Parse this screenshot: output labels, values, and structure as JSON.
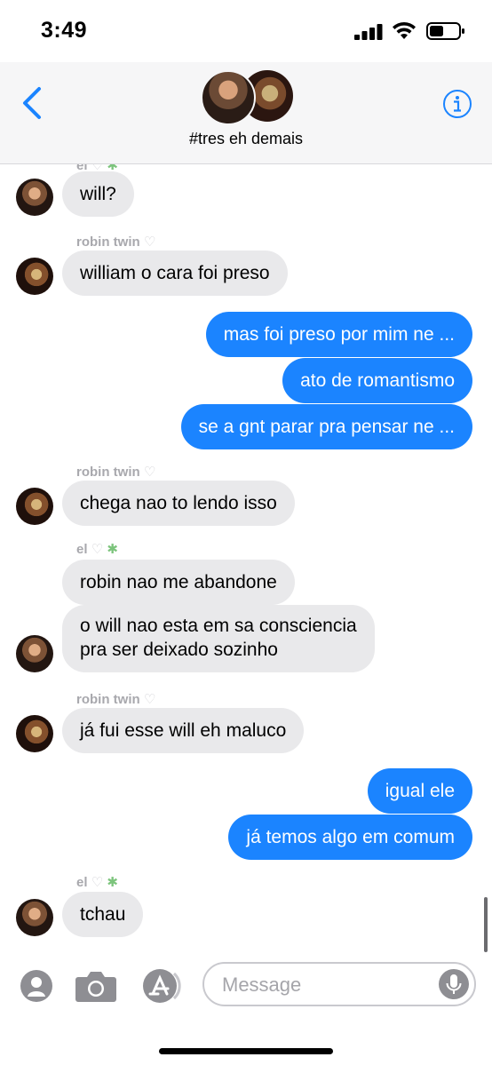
{
  "status_bar": {
    "time": "3:49"
  },
  "header": {
    "group_name": "#tres eh demais"
  },
  "senders": {
    "el": "el",
    "robin": "robin twin"
  },
  "messages": [
    {
      "from": "el",
      "text": "will?"
    },
    {
      "from": "robin",
      "text": "william o cara foi preso"
    },
    {
      "from": "me",
      "text": "mas foi preso por mim ne ..."
    },
    {
      "from": "me",
      "text": "ato de romantismo"
    },
    {
      "from": "me",
      "text": "se a gnt parar pra pensar ne ..."
    },
    {
      "from": "robin",
      "text": "chega nao to lendo isso"
    },
    {
      "from": "el",
      "text": "robin nao me abandone"
    },
    {
      "from": "el",
      "text_line1": "o will nao esta em sa consciencia",
      "text_line2": "pra ser deixado sozinho"
    },
    {
      "from": "robin",
      "text": "já fui esse will eh maluco"
    },
    {
      "from": "me",
      "text": "igual ele"
    },
    {
      "from": "me",
      "text": "já temos algo em comum"
    },
    {
      "from": "el",
      "text": "tchau"
    }
  ],
  "input": {
    "placeholder": "Message"
  },
  "icons": {
    "back": "chevron-left-icon",
    "info": "info-icon",
    "contact": "person-icon",
    "camera": "camera-icon",
    "apps": "app-store-icon",
    "mic": "microphone-icon",
    "heart": "white-heart-emoji",
    "fairy": "fairy-emoji"
  },
  "colors": {
    "accent": "#1b84ff",
    "incoming_bubble": "#e9e9eb",
    "sender_label": "#a8a8ad"
  }
}
